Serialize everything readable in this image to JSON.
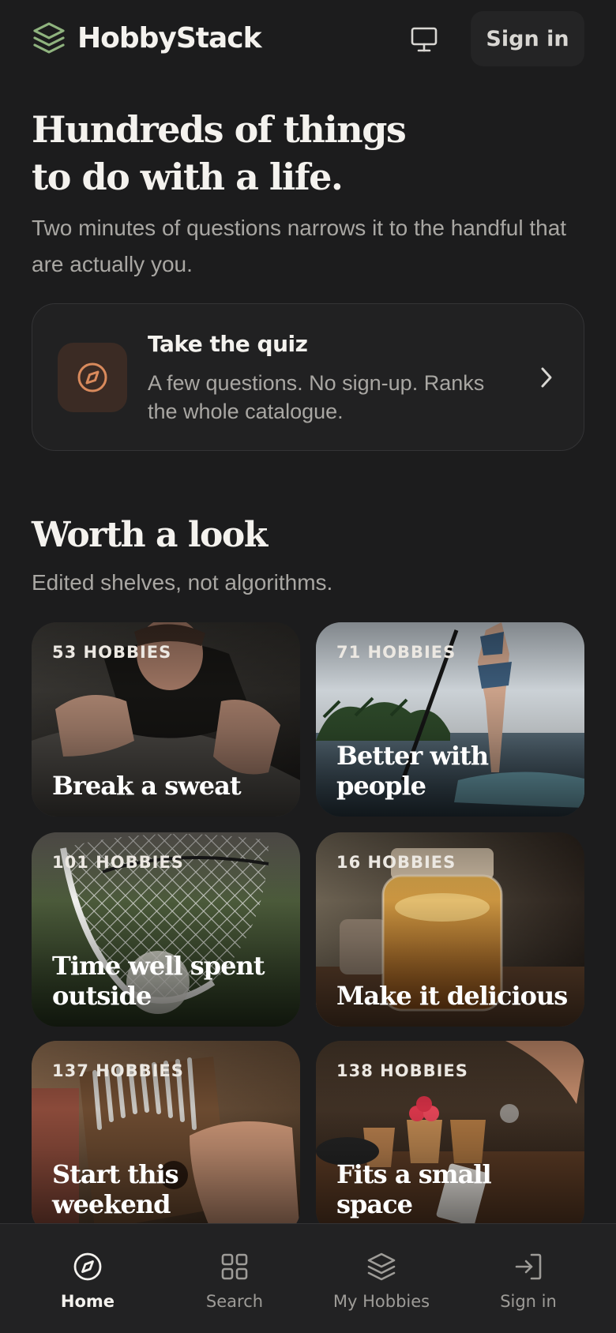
{
  "brand": {
    "name": "HobbyStack",
    "accent": "#8fb37e"
  },
  "header": {
    "monitor_icon": "monitor-icon",
    "signin_label": "Sign in"
  },
  "hero": {
    "title_line1": "Hundreds of things",
    "title_line2": "to do with a life.",
    "subtitle": "Two minutes of questions narrows it to the handful that are actually you."
  },
  "quiz": {
    "icon": "compass-icon",
    "title": "Take the quiz",
    "description": "A few questions. No sign-up. Ranks the whole catalogue.",
    "accent": "#d98a5c"
  },
  "shelves": {
    "title": "Worth a look",
    "subtitle": "Edited shelves, not algorithms.",
    "items": [
      {
        "count": "53 HOBBIES",
        "name": "Break a sweat"
      },
      {
        "count": "71 HOBBIES",
        "name": "Better with people"
      },
      {
        "count": "101 HOBBIES",
        "name": "Time well spent outside"
      },
      {
        "count": "16 HOBBIES",
        "name": "Make it delicious"
      },
      {
        "count": "137 HOBBIES",
        "name": "Start this weekend"
      },
      {
        "count": "138 HOBBIES",
        "name": "Fits a small space"
      }
    ]
  },
  "nav": {
    "items": [
      {
        "label": "Home",
        "icon": "compass-icon",
        "active": true
      },
      {
        "label": "Search",
        "icon": "grid-icon",
        "active": false
      },
      {
        "label": "My Hobbies",
        "icon": "layers-icon",
        "active": false
      },
      {
        "label": "Sign in",
        "icon": "sign-in-icon",
        "active": false
      }
    ]
  }
}
